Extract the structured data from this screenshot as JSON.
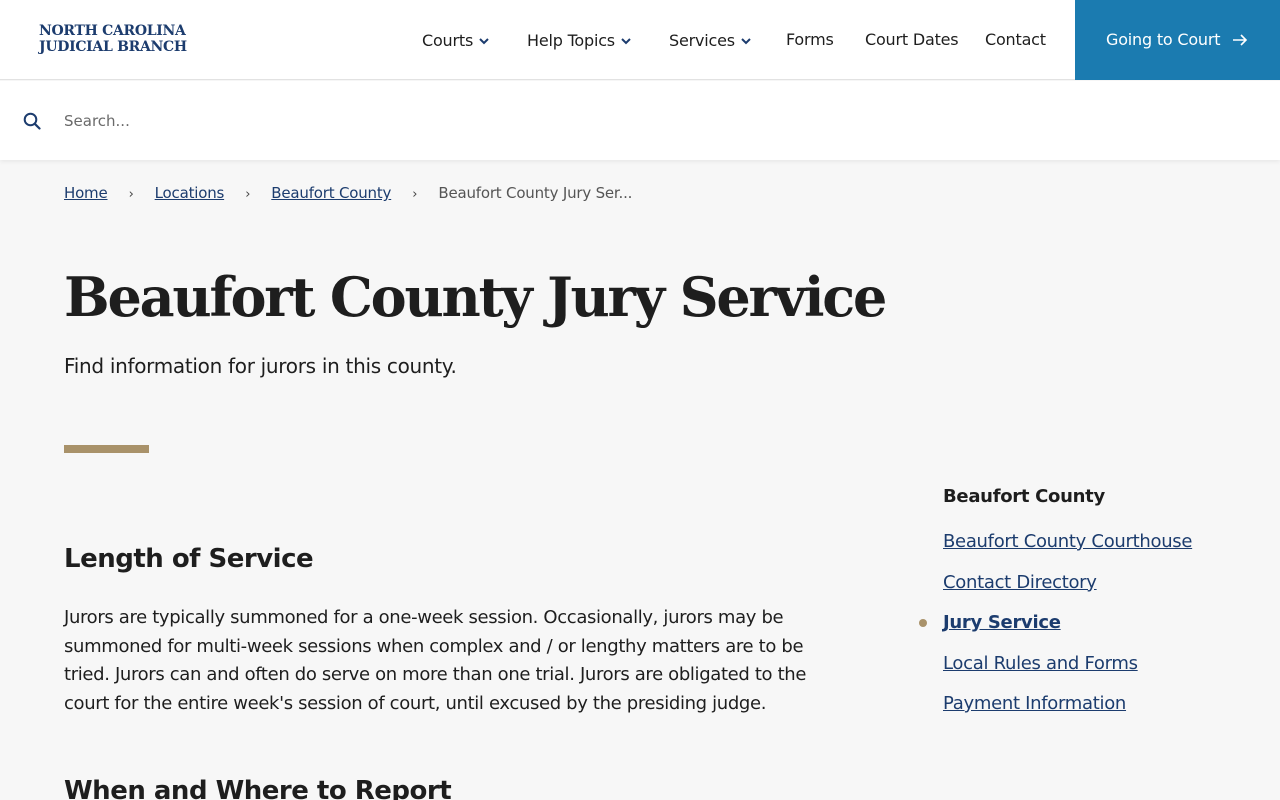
{
  "header": {
    "logo_line1": "NORTH CAROLINA",
    "logo_line2": "JUDICIAL BRANCH",
    "nav": [
      {
        "label": "Courts",
        "dropdown": true
      },
      {
        "label": "Help Topics",
        "dropdown": true
      },
      {
        "label": "Services",
        "dropdown": true
      },
      {
        "label": "Forms",
        "dropdown": false
      },
      {
        "label": "Court Dates",
        "dropdown": false
      },
      {
        "label": "Contact",
        "dropdown": false
      }
    ],
    "cta_label": "Going to Court",
    "cta_color": "#1b7bb0"
  },
  "search": {
    "placeholder": "Search..."
  },
  "breadcrumb": {
    "items": [
      "Home",
      "Locations",
      "Beaufort County"
    ],
    "current": "Beaufort County Jury Ser..."
  },
  "page": {
    "title": "Beaufort County Jury Service",
    "subtitle": "Find information for jurors in this county."
  },
  "content": {
    "section1_heading": "Length of Service",
    "section1_body": "Jurors are typically summoned for a one-week session. Occasionally, jurors may be summoned for multi-week sessions when complex and / or lengthy matters are to be tried. Jurors can and often do serve on more than one trial. Jurors are obligated to the court for the entire week's session of court, until excused by the presiding judge.",
    "section2_heading": "When and Where to Report"
  },
  "sidebar": {
    "heading": "Beaufort County",
    "items": [
      {
        "label": "Beaufort County Courthouse",
        "active": false
      },
      {
        "label": "Contact Directory",
        "active": false
      },
      {
        "label": "Jury Service",
        "active": true
      },
      {
        "label": "Local Rules and Forms",
        "active": false
      },
      {
        "label": "Payment Information",
        "active": false
      }
    ]
  },
  "colors": {
    "brand_navy": "#1c3c6e",
    "accent_gold": "#a9926a",
    "cta_blue": "#1b7bb0"
  }
}
